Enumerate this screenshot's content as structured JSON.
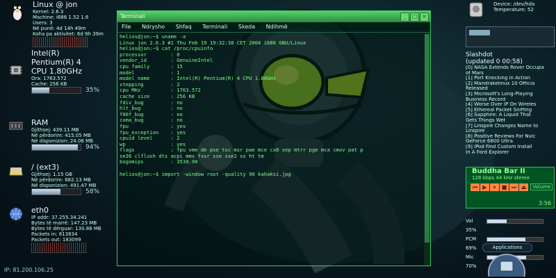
{
  "sysinfo": {
    "host": "Linux @ jon",
    "kernel": "Kernel:  2.6.3",
    "machine": "Machine:  i686  1.52  1.6",
    "users": "Users:  3",
    "uptime": "Në punë:  4d 14h 49m",
    "idle": "Koha pa aktivitet: 6d 9h 39m",
    "cpu_name1": "Intel(R)",
    "cpu_name2": "Pentium(R) 4",
    "cpu_name3": "CPU 1.80GHz",
    "cpu_freq": "Ora:  1763.572",
    "cpu_cache": "Cache:  256 KB",
    "cpu_pct": "35%",
    "cpu_level": 0.35,
    "ram_title": "RAM",
    "ram_size": "Gjithsej:  439.11 MB",
    "ram_used": "Në përdorim:  415.05 MB",
    "ram_free": "Në disponizion:  24.06 MB",
    "ram_pct": "94%",
    "ram_level": 0.94,
    "disk_title": "/ (ext3)",
    "disk_size": "Gjithsej:  1.15 GB",
    "disk_used": "Në përdorim:  682.13 MB",
    "disk_free": "Në disponizion:  491.47 MB",
    "disk_pct": "58%",
    "disk_level": 0.58,
    "net_title": "eth0",
    "net_ip": "IP addr:  37.255.34.241",
    "net_rx": "Bytes të marrë:  147.23 MB",
    "net_tx": "Bytes të dërguar:  130.86 MB",
    "net_prx": "Packets in:  813834",
    "net_ptx": "Packets out:  183099",
    "ip_line": "IP: 81.200.106.25"
  },
  "terminal": {
    "title": "Terminali",
    "menu": [
      "File",
      "Ndrysho",
      "Shfaq",
      "Terminali",
      "Skeda",
      "Ndihmë"
    ],
    "lines": [
      "helios@jon:~$ uname -a",
      "Linux jon 2.6.3 #1 Thu Feb 19 19:32:38 CET 2004 i686 GNU/Linux",
      "helios@jon:~$ cat /proc/cpuinfo",
      "processor        : 0",
      "vendor_id        : GenuineIntel",
      "cpu family       : 15",
      "model            : 1",
      "model name       : Intel(R) Pentium(R) 4 CPU 1.80GHz",
      "stepping         : 2",
      "cpu MHz          : 1763.572",
      "cache size       : 256 KB",
      "fdiv_bug         : no",
      "hlt_bug          : no",
      "f00f_bug         : no",
      "coma_bug         : no",
      "fpu              : yes",
      "fpu_exception    : yes",
      "cpuid level      : 2",
      "wp               : yes",
      "flags            : fpu vme de pse tsc msr pae mce cx8 sep mtrr pge mca cmov pat p",
      "se36 clflush dts acpi mmx fxsr sse sse2 ss ht tm",
      "bogomips         : 3530.94",
      "",
      "helios@jon:~$ import -window root -quality 90 kahaksi.jpg"
    ]
  },
  "right": {
    "device": "Device: /dev/hda",
    "temperature": "Temperature:  52",
    "news_title": "Slashdot",
    "news_updated": "(updated 0 00:58)",
    "news": [
      "[0] NASA Extends Rover Occupa",
      "     of Mars",
      "[1] Port Knocking in Action",
      "[2] Mandrakelinux 10 Officia",
      "     Released",
      "[3] Microsoft's Long-Playing",
      "     Business Record",
      "[4] Worse Over IP On Wireles",
      "[5] Ethereal Packet Sniffing",
      "[6] Sapphire: A Liquid That",
      "     Gets Things Wet",
      "[7] Linspire Changes Name to",
      "     Linspire",
      "[8] Positive Reviews For Nvic",
      "     GeForce 6800 Ultra",
      "[9] iPod Find Custom Install",
      "     In A Ford Explorer"
    ],
    "player_title": "Buddha Bar II",
    "player_info": "128 kbps  44 kHz stereo",
    "player_time": "3:56",
    "volume_label": "Volume",
    "vol_label": "Vol",
    "vol_pct": "35%",
    "vol_level": 0.35,
    "pcm_label": "PCM",
    "pcm_pct": "69%",
    "pcm_level": 0.69,
    "mic_label": "Mic",
    "mic_pct": "70%",
    "mic_level": 0.7,
    "apps_label": "Applications"
  },
  "colors": {
    "terminal_text": "#7dff8a",
    "title_bar": "#3ea851",
    "background": "#07151b"
  }
}
